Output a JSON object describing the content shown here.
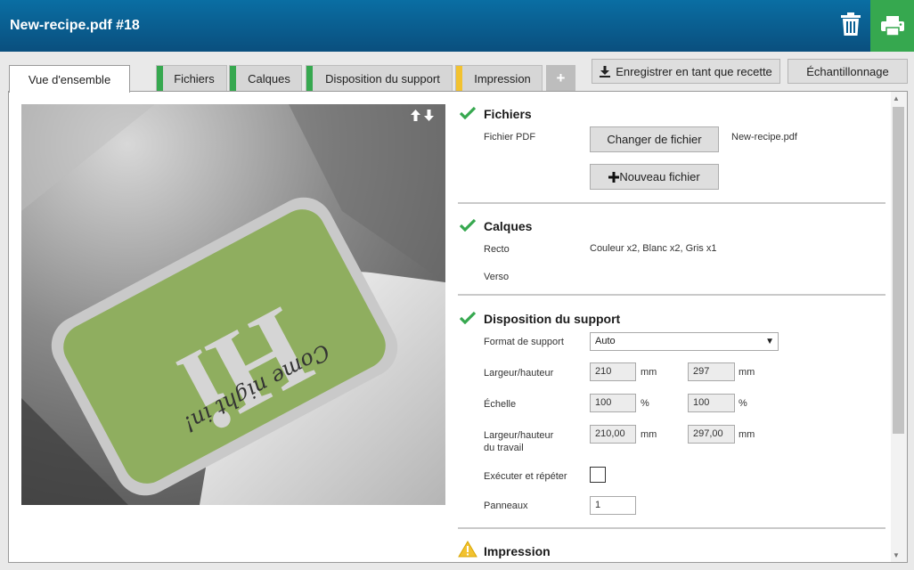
{
  "header": {
    "title": "New-recipe.pdf #18"
  },
  "tabs": [
    {
      "label": "Vue d'ensemble"
    },
    {
      "label": "Fichiers",
      "color": "#36a84f"
    },
    {
      "label": "Calques",
      "color": "#36a84f"
    },
    {
      "label": "Disposition du support",
      "color": "#36a84f"
    },
    {
      "label": "Impression",
      "color": "#f2c230"
    },
    {
      "label": "+"
    }
  ],
  "toolbar": {
    "save_recipe_label": "Enregistrer en tant que recette",
    "sampling_label": "Échantillonnage"
  },
  "preview": {
    "text_hi": "Hi",
    "text_script": "Come night in!"
  },
  "sections": {
    "files": {
      "title": "Fichiers",
      "pdf_label": "Fichier PDF",
      "change_button": "Changer de fichier",
      "filename": "New-recipe.pdf",
      "new_button": "Nouveau fichier"
    },
    "layers": {
      "title": "Calques",
      "recto_label": "Recto",
      "recto_value": "Couleur x2, Blanc x2, Gris x1",
      "verso_label": "Verso"
    },
    "layout": {
      "title": "Disposition du support",
      "format_label": "Format de support",
      "format_value": "Auto",
      "size_label": "Largeur/hauteur",
      "width": "210",
      "height": "297",
      "unit_mm": "mm",
      "scale_label": "Échelle",
      "scale_x": "100",
      "scale_y": "100",
      "unit_pct": "%",
      "job_size_label_1": "Largeur/hauteur",
      "job_size_label_2": "du travail",
      "job_width": "210,00",
      "job_height": "297,00",
      "step_repeat_label": "Exécuter et répéter",
      "panels_label": "Panneaux",
      "panels_value": "1"
    },
    "print": {
      "title": "Impression"
    }
  },
  "colors": {
    "header": "#0a5f93",
    "accent_green": "#36a84f",
    "warning": "#f2c230"
  }
}
